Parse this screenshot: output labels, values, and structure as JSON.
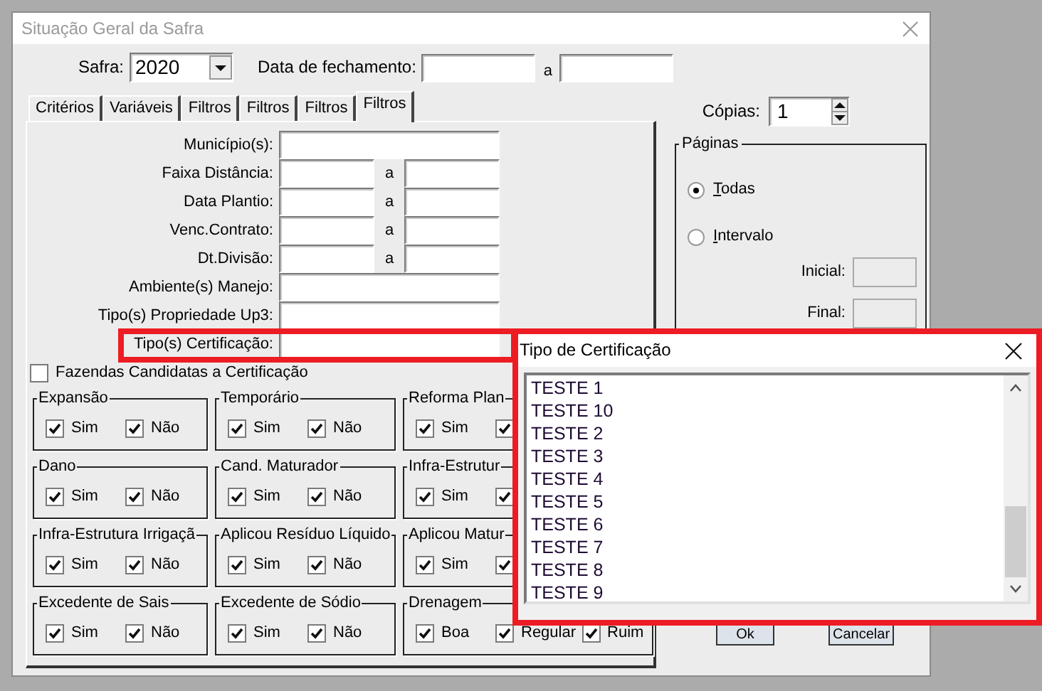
{
  "window": {
    "title": "Situação Geral da Safra"
  },
  "safra": {
    "label": "Safra:",
    "value": "2020"
  },
  "closing_date": {
    "label": "Data de fechamento:",
    "separator": "a"
  },
  "tabs": [
    {
      "label": "Critérios",
      "selected": false
    },
    {
      "label": "Variáveis",
      "selected": false
    },
    {
      "label": "Filtros",
      "selected": false
    },
    {
      "label": "Filtros",
      "selected": false
    },
    {
      "label": "Filtros",
      "selected": false
    },
    {
      "label": "Filtros",
      "selected": true
    }
  ],
  "filters": [
    {
      "label": "Município(s):",
      "kind": "single"
    },
    {
      "label": "Faixa Distância:",
      "kind": "range",
      "separator": "a"
    },
    {
      "label": "Data Plantio:",
      "kind": "range",
      "separator": "a"
    },
    {
      "label": "Venc.Contrato:",
      "kind": "range",
      "separator": "a"
    },
    {
      "label": "Dt.Divisão:",
      "kind": "range",
      "separator": "a"
    },
    {
      "label": "Ambiente(s) Manejo:",
      "kind": "single"
    },
    {
      "label": "Tipo(s) Propriedade Up3:",
      "kind": "single"
    },
    {
      "label": "Tipo(s) Certificação:",
      "kind": "single"
    }
  ],
  "candidates_checkbox": {
    "label": "Fazendas Candidatas a Certificação",
    "checked": false
  },
  "groups": [
    {
      "title": "Expansão",
      "options": [
        {
          "label": "Sim",
          "checked": true
        },
        {
          "label": "Não",
          "checked": true
        }
      ]
    },
    {
      "title": "Temporário",
      "options": [
        {
          "label": "Sim",
          "checked": true
        },
        {
          "label": "Não",
          "checked": true
        }
      ]
    },
    {
      "title": "Reforma Plan",
      "options": [
        {
          "label": "Sim",
          "checked": true
        },
        {
          "checked": true
        }
      ]
    },
    {
      "title": "Dano",
      "options": [
        {
          "label": "Sim",
          "checked": true
        },
        {
          "label": "Não",
          "checked": true
        }
      ]
    },
    {
      "title": "Cand. Maturador",
      "options": [
        {
          "label": "Sim",
          "checked": true
        },
        {
          "label": "Não",
          "checked": true
        }
      ]
    },
    {
      "title": "Infra-Estrutur",
      "options": [
        {
          "label": "Sim",
          "checked": true
        },
        {
          "checked": true
        }
      ]
    },
    {
      "title": "Infra-Estrutura Irrigaçã",
      "options": [
        {
          "label": "Sim",
          "checked": true
        },
        {
          "label": "Não",
          "checked": true
        }
      ]
    },
    {
      "title": "Aplicou Resíduo Líquido",
      "options": [
        {
          "label": "Sim",
          "checked": true
        },
        {
          "label": "Não",
          "checked": true
        }
      ]
    },
    {
      "title": "Aplicou Matur",
      "options": [
        {
          "label": "Sim",
          "checked": true
        },
        {
          "checked": true
        }
      ]
    },
    {
      "title": "Excedente de Sais",
      "options": [
        {
          "label": "Sim",
          "checked": true
        },
        {
          "label": "Não",
          "checked": true
        }
      ]
    },
    {
      "title": "Excedente de Sódio",
      "options": [
        {
          "label": "Sim",
          "checked": true
        },
        {
          "label": "Não",
          "checked": true
        }
      ]
    },
    {
      "title": "Drenagem",
      "options": [
        {
          "label": "Boa",
          "checked": true
        },
        {
          "label": "Regular",
          "checked": true
        },
        {
          "label": "Ruim",
          "checked": true
        }
      ]
    }
  ],
  "copies": {
    "label": "Cópias:",
    "value": "1"
  },
  "pages": {
    "title": "Páginas",
    "options": [
      {
        "label": "Todas",
        "selected": true
      },
      {
        "label": "Intervalo",
        "selected": false
      }
    ],
    "start_label": "Inicial:",
    "end_label": "Final:"
  },
  "buttons": [
    "Ok",
    "Cancelar"
  ],
  "popup": {
    "title": "Tipo de Certificação",
    "items": [
      "TESTE 1",
      "TESTE 10",
      "TESTE 2",
      "TESTE 3",
      "TESTE 4",
      "TESTE 5",
      "TESTE 6",
      "TESTE 7",
      "TESTE 8",
      "TESTE 9"
    ]
  }
}
